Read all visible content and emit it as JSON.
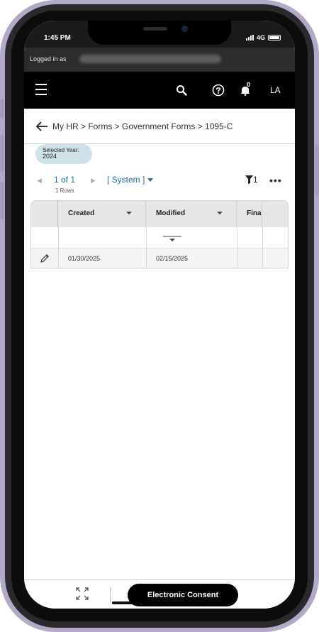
{
  "status_bar": {
    "time": "1:45 PM",
    "network": "4G"
  },
  "login_bar": {
    "label": "Logged in as"
  },
  "header": {
    "menu_icon": "hamburger-icon",
    "search_icon": "search-icon",
    "help_icon": "help-circle-icon",
    "notifications_icon": "bell-icon",
    "notification_count": "0",
    "user_initials": "LA"
  },
  "breadcrumb": {
    "text": "My HR > Forms > Government Forms > 1095-C"
  },
  "year_chip": {
    "label": "Selected Year:",
    "value": "2024"
  },
  "pager": {
    "count": "1 of 1",
    "rows": "1 Rows",
    "view": "[ System ]",
    "filter_count": "1",
    "more": "•••"
  },
  "grid": {
    "columns": [
      "Created",
      "Modified",
      "Fina"
    ],
    "rows": [
      {
        "created": "01/30/2025",
        "modified": "02/15/2025",
        "final": ""
      }
    ]
  },
  "bottom_bar": {
    "consent_label": "Electronic Consent"
  }
}
